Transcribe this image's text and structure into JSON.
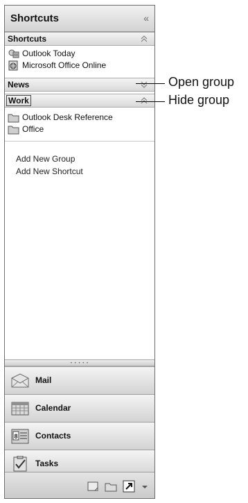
{
  "pane": {
    "title": "Shortcuts",
    "collapse_glyph": "«"
  },
  "groups": {
    "shortcuts": {
      "title": "Shortcuts",
      "items": [
        {
          "label": "Outlook Today",
          "icon": "outlook-today-icon"
        },
        {
          "label": "Microsoft Office Online",
          "icon": "office-online-icon"
        }
      ]
    },
    "news": {
      "title": "News"
    },
    "work": {
      "title": "Work",
      "items": [
        {
          "label": "Outlook Desk Reference",
          "icon": "folder-icon"
        },
        {
          "label": "Office",
          "icon": "folder-icon"
        }
      ]
    }
  },
  "actions": {
    "add_group": "Add New Group",
    "add_shortcut": "Add New Shortcut"
  },
  "nav": {
    "mail": "Mail",
    "calendar": "Calendar",
    "contacts": "Contacts",
    "tasks": "Tasks"
  },
  "callouts": {
    "open_group": "Open group",
    "hide_group": "Hide group"
  }
}
